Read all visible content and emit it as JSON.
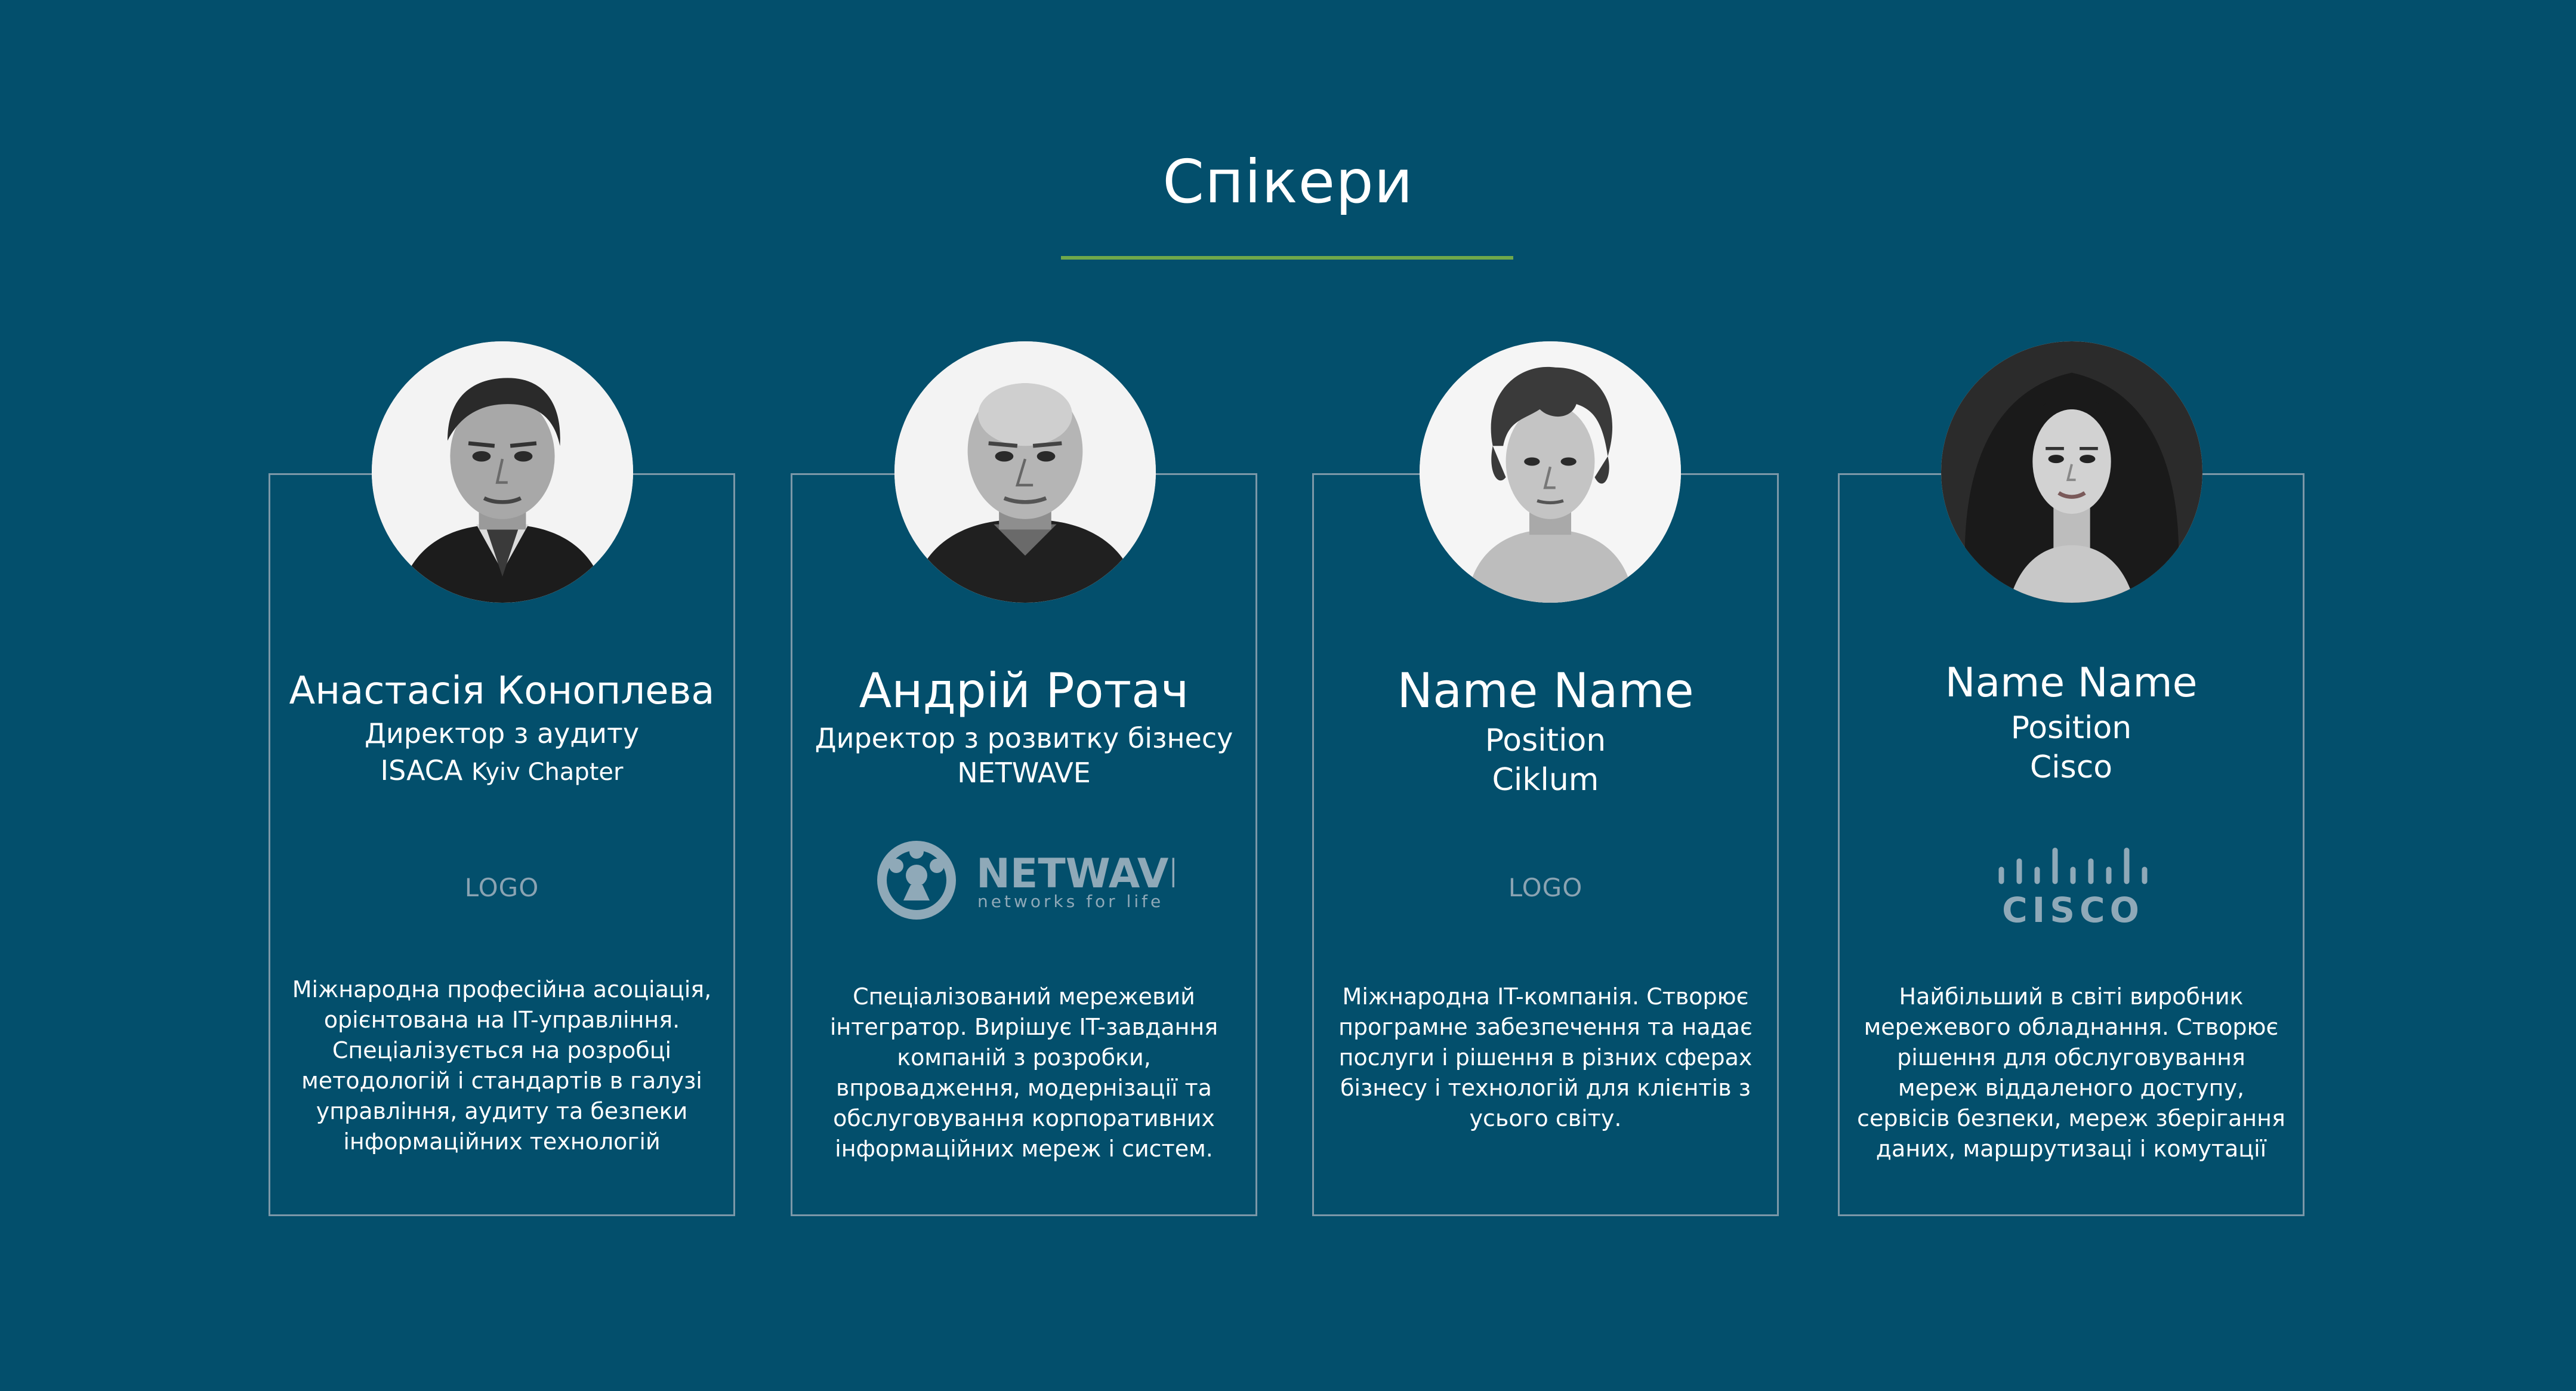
{
  "section": {
    "title": "Спікери",
    "accent_color": "#6fa84a",
    "background_color": "#034f6c"
  },
  "speakers": [
    {
      "name": "Анастасія Коноплева",
      "position": "Директор з аудиту",
      "company": "ISACA",
      "company_suffix": "Kyiv Chapter",
      "logo_text": "LOGO",
      "description": "Міжнародна професійна асоціація, орієнтована на IT-управління. Спеціалізується на розробці методологій і стандартів в галузі управління, аудиту та безпеки інформаційних технологій",
      "photo_icon": "speaker-photo-older-man"
    },
    {
      "name": "Андрій Ротач",
      "position": "Директор з розвитку бізнесу",
      "company": "NETWAVE",
      "logo_name": "NETWAVE",
      "logo_tagline": "networks for life",
      "description": "Спеціалізований мережевий інтегратор. Вирішує IT-завдання компаній з розробки, впровадження, модернізації та обслуговування корпоративних інформаційних мереж і систем.",
      "photo_icon": "speaker-photo-bald-man"
    },
    {
      "name": "Name Name",
      "position": "Position",
      "company": "Ciklum",
      "logo_text": "LOGO",
      "description": "Міжнародна IT-компанія. Створює програмне забезпечення та надає послуги і рішення в різних сферах бізнесу і технологій для клієнтів з усього світу.",
      "photo_icon": "speaker-photo-young-man"
    },
    {
      "name": "Name Name",
      "position": "Position",
      "company": "Cisco",
      "logo_name": "CISCO",
      "description": "Найбільший в світі виробник мережевого обладнання. Створює рішення для обслуговування мереж віддаленого доступу, сервісів безпеки, мереж зберігання даних, маршрутизаці і комутації",
      "photo_icon": "speaker-photo-woman"
    }
  ]
}
